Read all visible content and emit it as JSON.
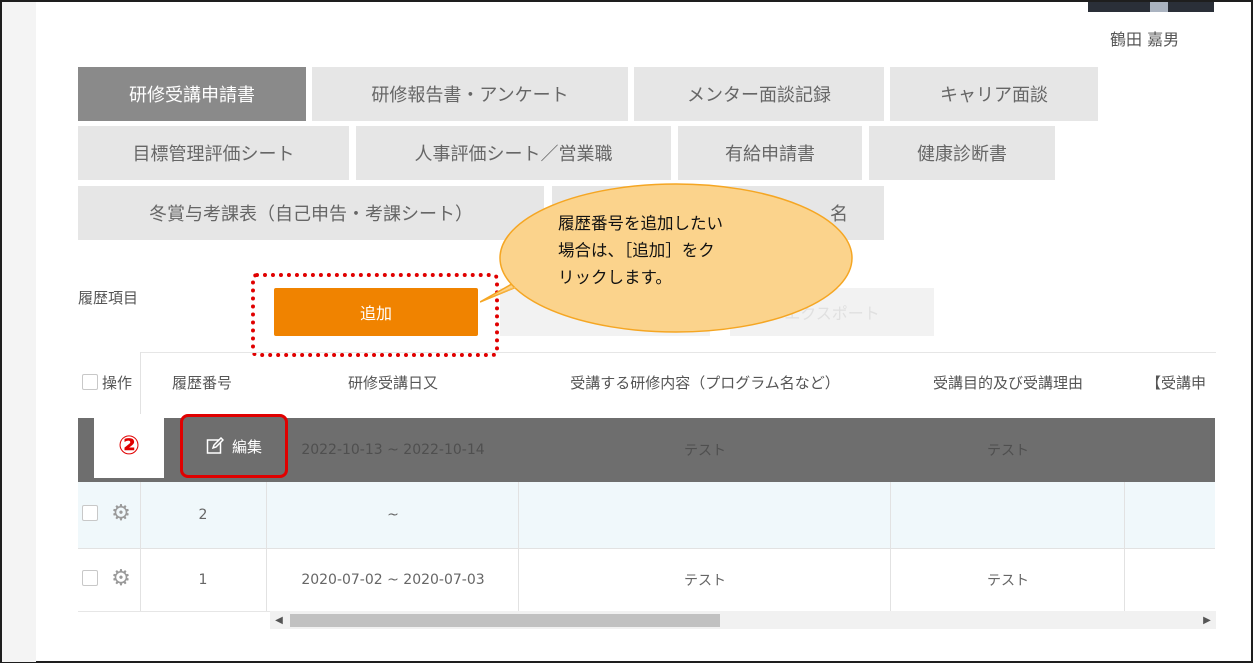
{
  "user": {
    "name": "鶴田 嘉男"
  },
  "tabs": [
    {
      "label": "研修受講申請書",
      "active": true
    },
    {
      "label": "研修報告書・アンケート",
      "active": false
    },
    {
      "label": "メンター面談記録",
      "active": false
    },
    {
      "label": "キャリア面談",
      "active": false
    },
    {
      "label": "目標管理評価シート",
      "active": false
    },
    {
      "label": "人事評価シート／営業職",
      "active": false
    },
    {
      "label": "有給申請書",
      "active": false
    },
    {
      "label": "健康診断書",
      "active": false
    },
    {
      "label": "冬賞与考課表（自己申告・考課シート）",
      "active": false
    },
    {
      "label": "名",
      "active": false
    }
  ],
  "history": {
    "label": "履歴項目",
    "add_button": "追加",
    "ghost_button": "エクスポート"
  },
  "table": {
    "headers": [
      "操作",
      "履歴番号",
      "研修受講日又",
      "受講する研修内容（プログラム名など）",
      "受講目的及び受講理由",
      "【受講申"
    ],
    "edit_label": "編集",
    "rows": [
      {
        "number": "",
        "dates": "2022-10-13 ~ 2022-10-14",
        "content": "テスト",
        "purpose": "テスト"
      },
      {
        "number": "2",
        "dates": "~",
        "content": "",
        "purpose": ""
      },
      {
        "number": "1",
        "dates": "2020-07-02 ~ 2020-07-03",
        "content": "テスト",
        "purpose": "テスト"
      }
    ]
  },
  "annotation": {
    "step_marker": "②",
    "callout_line1": "履歴番号を追加したい",
    "callout_line2": "場合は、［追加］をク",
    "callout_line3": "リックします。",
    "callout_color": "#fbd38c",
    "highlight_color": "#e00000"
  },
  "colors": {
    "accent": "#f08300",
    "active_tab": "#8a8a8a",
    "selected_row": "#6e6e6e"
  }
}
